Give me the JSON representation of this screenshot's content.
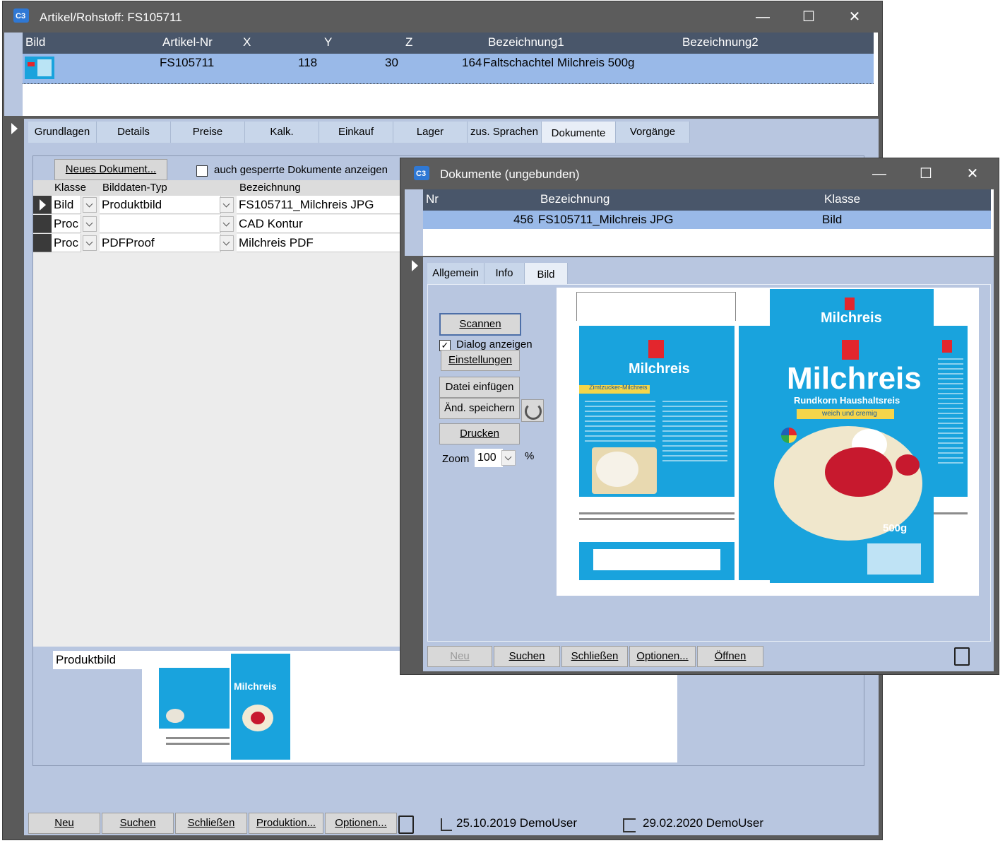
{
  "main_window": {
    "title": "Artikel/Rohstoff: FS105711",
    "columns": [
      "Bild",
      "Artikel-Nr",
      "X",
      "Y",
      "Z",
      "Bezeichnung1",
      "Bezeichnung2"
    ],
    "row": {
      "artikel_nr": "FS105711",
      "x": "118",
      "y": "30",
      "z": "164",
      "bezeichnung1": "Faltschachtel Milchreis 500g",
      "bezeichnung2": ""
    },
    "tabs": [
      "Grundlagen",
      "Details",
      "Preise",
      "Kalk.",
      "Einkauf",
      "Lager",
      "zus. Sprachen",
      "Dokumente",
      "Vorgänge"
    ],
    "active_tab": "Dokumente",
    "new_doc_button": "Neues Dokument...",
    "show_locked_label": "auch gesperrte Dokumente anzeigen",
    "doc_headers": [
      "Klasse",
      "Bilddaten-Typ",
      "Bezeichnung"
    ],
    "doc_rows": [
      {
        "klasse": "Bild",
        "typ": "Produktbild",
        "bezeichnung": "FS105711_Milchreis JPG"
      },
      {
        "klasse": "Proc",
        "typ": "",
        "bezeichnung": "CAD Kontur"
      },
      {
        "klasse": "Proc",
        "typ": "PDFProof",
        "bezeichnung": "Milchreis PDF"
      }
    ],
    "preview_label": "Produktbild",
    "bottom_buttons": [
      "Neu",
      "Suchen",
      "Schließen",
      "Produktion...",
      "Optionen..."
    ],
    "created": "25.10.2019 DemoUser",
    "modified": "29.02.2020 DemoUser"
  },
  "doc_window": {
    "title": "Dokumente (ungebunden)",
    "columns": [
      "Nr",
      "Bezeichnung",
      "Klasse"
    ],
    "row": {
      "nr": "456",
      "bezeichnung": "FS105711_Milchreis JPG",
      "klasse": "Bild"
    },
    "tabs": [
      "Allgemein",
      "Info",
      "Bild"
    ],
    "active_tab": "Bild",
    "scan_button": "Scannen",
    "dialog_label": "Dialog anzeigen",
    "dialog_checked": true,
    "settings_button": "Einstellungen",
    "insert_button": "Datei einfügen",
    "save_button": "Änd. speichern",
    "print_button": "Drucken",
    "zoom_label": "Zoom",
    "zoom_value": "100",
    "zoom_unit": "%",
    "bottom_buttons": [
      "Neu",
      "Suchen",
      "Schließen",
      "Optionen...",
      "Öffnen"
    ],
    "artwork": {
      "brand": "Milchreis",
      "subtitle": "Rundkorn Haushaltsreis",
      "tagline": "weich und cremig",
      "weight": "500g",
      "ribbon": "Zimtzucker-Milchreis"
    }
  },
  "colors": {
    "titlebar": "#5c5c5c",
    "panel": "#b8c6e0",
    "grid_header": "#49566a",
    "selection": "#99b9e8",
    "package_blue": "#19a3dd"
  }
}
